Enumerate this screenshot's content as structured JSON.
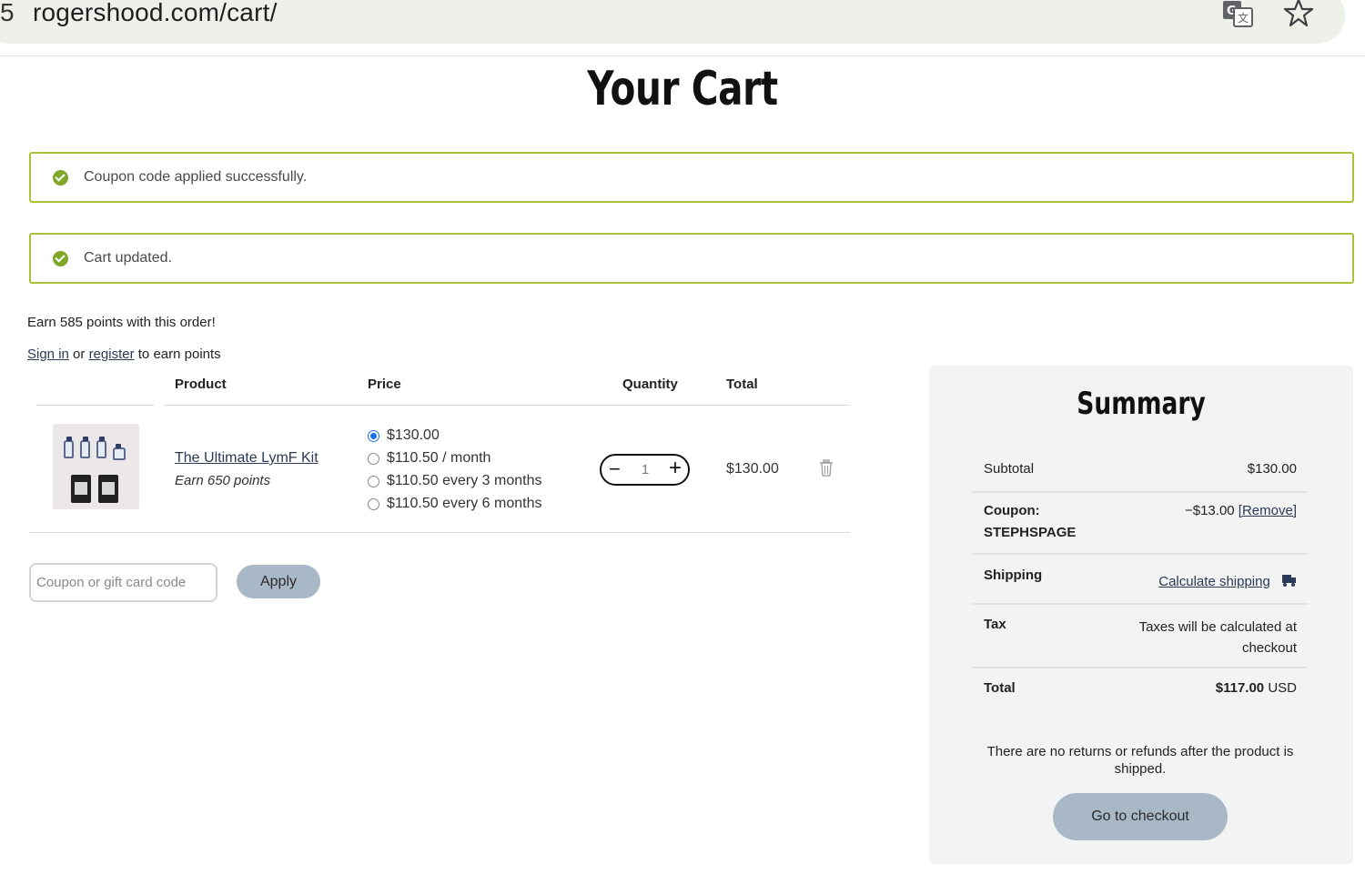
{
  "browser": {
    "url": "rogershood.com/cart/",
    "edge_glyph": "5",
    "icons": [
      "translate-icon",
      "star-icon"
    ]
  },
  "page": {
    "title": "Your Cart"
  },
  "notices": [
    {
      "text": "Coupon code applied successfully.",
      "icon": "check-circle-icon"
    },
    {
      "text": "Cart updated.",
      "icon": "check-circle-icon"
    }
  ],
  "points": {
    "earn_text": "Earn 585 points with this order!",
    "sign_in": "Sign in",
    "or": " or ",
    "register": "register",
    "suffix": " to earn points"
  },
  "table": {
    "headers": {
      "product": "Product",
      "price": "Price",
      "quantity": "Quantity",
      "total": "Total"
    },
    "items": [
      {
        "name": "The Ultimate LymF Kit",
        "earn": "Earn 650 points",
        "price_options": [
          {
            "label": "$130.00",
            "selected": true
          },
          {
            "label": "$110.50 / month",
            "selected": false
          },
          {
            "label": "$110.50 every 3 months",
            "selected": false
          },
          {
            "label": "$110.50 every 6 months",
            "selected": false
          }
        ],
        "quantity": "1",
        "total": "$130.00"
      }
    ]
  },
  "coupon": {
    "placeholder": "Coupon or gift card code",
    "apply_label": "Apply"
  },
  "summary": {
    "title": "Summary",
    "subtotal_label": "Subtotal",
    "subtotal_value": "$130.00",
    "coupon_label_1": "Coupon:",
    "coupon_label_2": "STEPHSPAGE",
    "coupon_value": "−$13.00",
    "remove_label": "[Remove]",
    "shipping_label": "Shipping",
    "shipping_link": "Calculate shipping",
    "tax_label": "Tax",
    "tax_value_1": "Taxes will be calculated at",
    "tax_value_2": "checkout",
    "total_label": "Total",
    "total_value": "$117.00",
    "total_currency": " USD",
    "note": "There are no returns or refunds after the product is shipped.",
    "checkout_label": "Go to checkout"
  },
  "colors": {
    "success_border": "#a9c23a",
    "success_icon": "#7fa82a",
    "button_bg": "#a9b8c6",
    "link": "#2b3a55",
    "radio_selected": "#1a73e8"
  }
}
